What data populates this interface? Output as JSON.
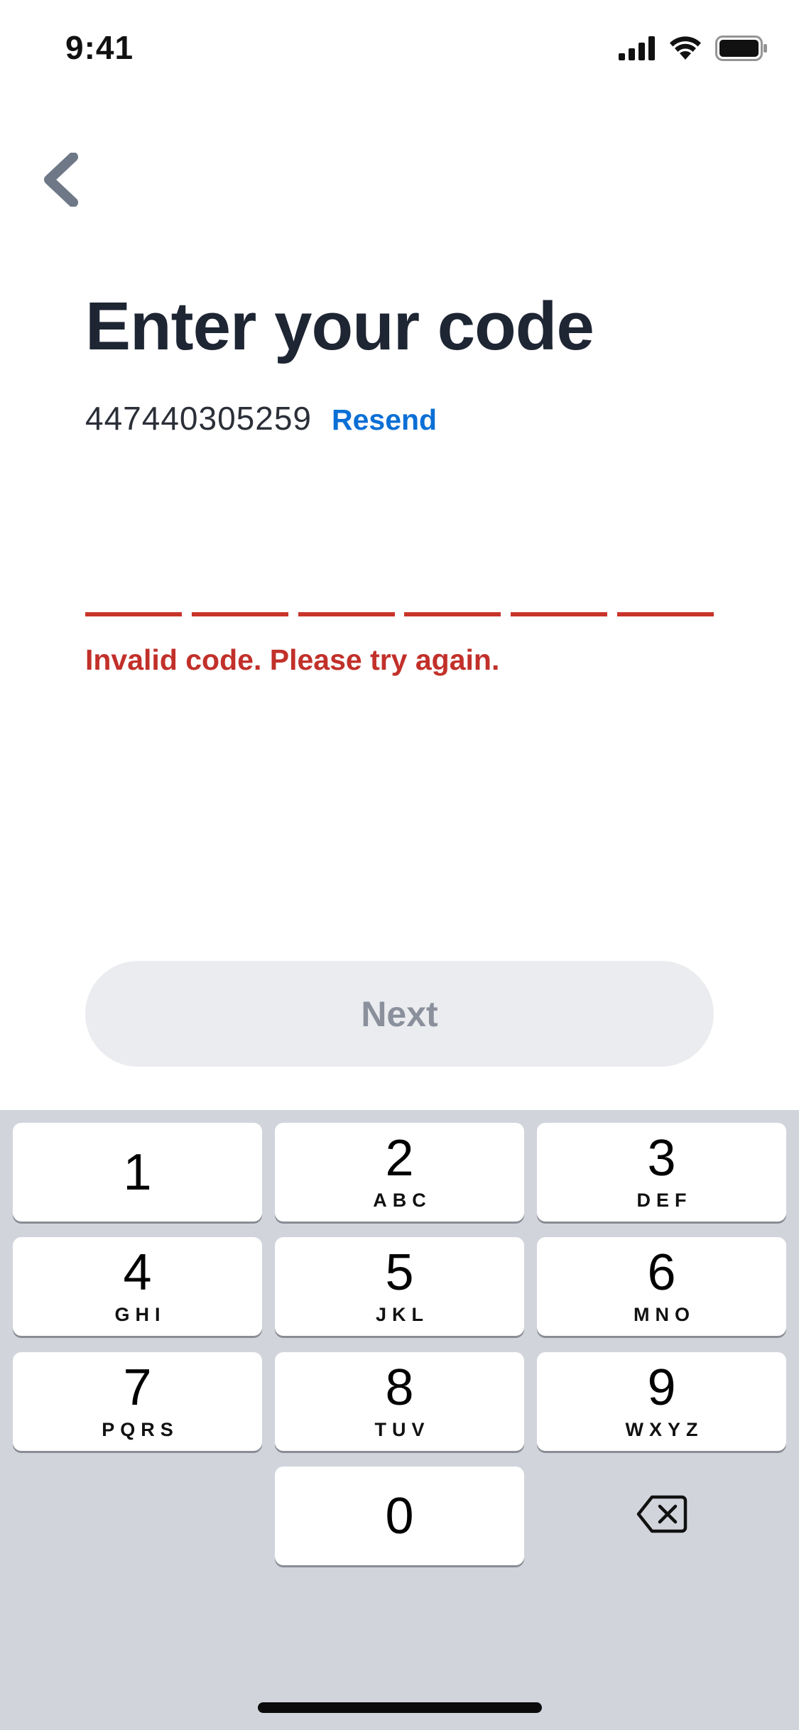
{
  "status_bar": {
    "time": "9:41",
    "icons": [
      "cellular-signal-icon",
      "wifi-icon",
      "battery-icon"
    ]
  },
  "header": {
    "back_icon": "chevron-left-icon",
    "title": "Enter your code"
  },
  "verification": {
    "phone_number": "447440305259",
    "resend_label": "Resend",
    "code_length": 6,
    "code_value": "",
    "error_message": "Invalid code. Please try again."
  },
  "actions": {
    "next_label": "Next",
    "next_enabled": false
  },
  "keypad": {
    "keys": [
      {
        "digit": "1",
        "letters": ""
      },
      {
        "digit": "2",
        "letters": "ABC"
      },
      {
        "digit": "3",
        "letters": "DEF"
      },
      {
        "digit": "4",
        "letters": "GHI"
      },
      {
        "digit": "5",
        "letters": "JKL"
      },
      {
        "digit": "6",
        "letters": "MNO"
      },
      {
        "digit": "7",
        "letters": "PQRS"
      },
      {
        "digit": "8",
        "letters": "TUV"
      },
      {
        "digit": "9",
        "letters": "WXYZ"
      },
      {
        "digit": "0",
        "letters": ""
      }
    ],
    "delete_icon": "backspace-icon"
  },
  "colors": {
    "title": "#1e2533",
    "link": "#0a6fd6",
    "error": "#c2302a",
    "button_disabled_bg": "#ebecef",
    "button_disabled_text": "#8a919c",
    "keyboard_bg": "#d1d4db"
  }
}
